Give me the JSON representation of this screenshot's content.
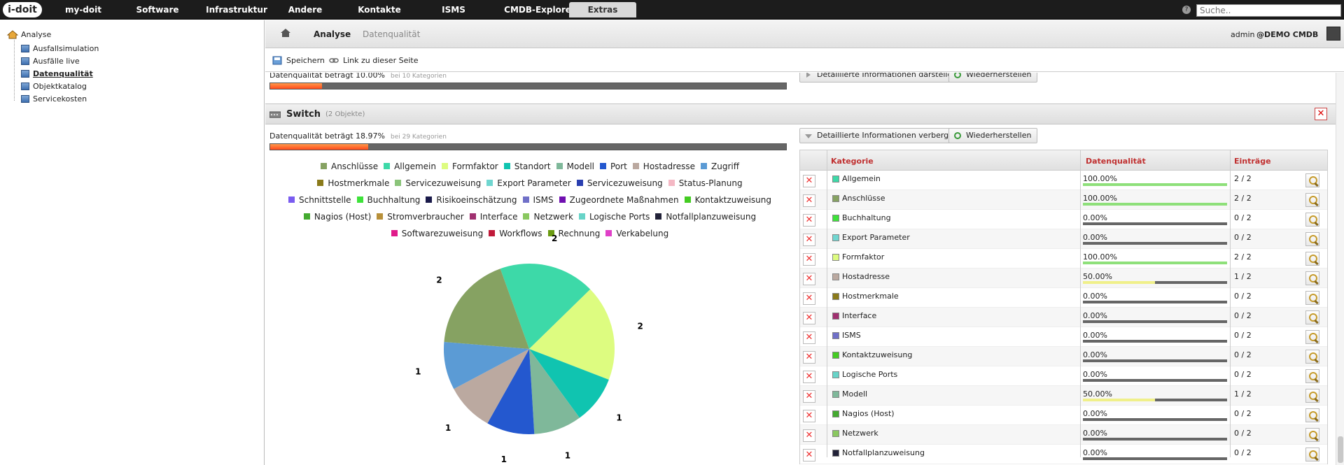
{
  "topnav": {
    "logo": "i-doit",
    "items": [
      "my-doit",
      "Software",
      "Infrastruktur",
      "Andere",
      "Kontakte",
      "ISMS",
      "CMDB-Explorer",
      "Extras"
    ],
    "active": "Extras",
    "search_placeholder": "Suche.."
  },
  "sidebar": {
    "root": "Analyse",
    "items": [
      "Ausfallsimulation",
      "Ausfälle live",
      "Datenqualität",
      "Objektkatalog",
      "Servicekosten"
    ],
    "current": "Datenqualität"
  },
  "breadcrumb": {
    "items": [
      "Analyse",
      "Datenqualität"
    ],
    "user": "admin",
    "tenant": "@DEMO CMDB"
  },
  "toolbar": {
    "save": "Speichern",
    "link": "Link zu dieser Seite"
  },
  "prev_section": {
    "quality_text": "Datenqualität beträgt 10.00%",
    "categories_text": "bei 10 Kategorien",
    "quality_percent": 10,
    "btn_details": "Detaillierte Informationen darstellen",
    "btn_restore": "Wiederherstellen"
  },
  "section": {
    "title": "Switch",
    "count": "(2 Objekte)",
    "quality_text": "Datenqualität beträgt 18.97%",
    "categories_text": "bei 29 Kategorien",
    "quality_percent": 18.97,
    "btn_details": "Detaillierte Informationen verbergen",
    "btn_restore": "Wiederherstellen"
  },
  "legend": [
    {
      "label": "Anschlüsse",
      "color": "#86a262"
    },
    {
      "label": "Allgemein",
      "color": "#3dd9a8"
    },
    {
      "label": "Formfaktor",
      "color": "#ddfc80"
    },
    {
      "label": "Standort",
      "color": "#10c4b0"
    },
    {
      "label": "Modell",
      "color": "#7fb89a"
    },
    {
      "label": "Port",
      "color": "#2458cf"
    },
    {
      "label": "Hostadresse",
      "color": "#bba9a0"
    },
    {
      "label": "Zugriff",
      "color": "#5b9bd5"
    },
    {
      "label": "Hostmerkmale",
      "color": "#8a7a1a"
    },
    {
      "label": "Servicezuweisung",
      "color": "#8bc47a"
    },
    {
      "label": "Export Parameter",
      "color": "#70d6d0"
    },
    {
      "label": "Servicezuweisung",
      "color": "#2a3fb0"
    },
    {
      "label": "Status-Planung",
      "color": "#f4b8c4"
    },
    {
      "label": "Schnittstelle",
      "color": "#7a5cf0"
    },
    {
      "label": "Buchhaltung",
      "color": "#3ee23a"
    },
    {
      "label": "Risikoeinschätzung",
      "color": "#1a1a4a"
    },
    {
      "label": "ISMS",
      "color": "#7070c8"
    },
    {
      "label": "Zugeordnete Maßnahmen",
      "color": "#7010b0"
    },
    {
      "label": "Kontaktzuweisung",
      "color": "#44cc22"
    },
    {
      "label": "Nagios (Host)",
      "color": "#44aa30"
    },
    {
      "label": "Stromverbraucher",
      "color": "#b8903a"
    },
    {
      "label": "Interface",
      "color": "#a03070"
    },
    {
      "label": "Netzwerk",
      "color": "#8ac860"
    },
    {
      "label": "Logische Ports",
      "color": "#68d4c8"
    },
    {
      "label": "Notfallplanzuweisung",
      "color": "#222238"
    },
    {
      "label": "Softwarezuweisung",
      "color": "#e01a8a"
    },
    {
      "label": "Workflows",
      "color": "#c01a3a"
    },
    {
      "label": "Rechnung",
      "color": "#6a9a10"
    },
    {
      "label": "Verkabelung",
      "color": "#e040c8"
    }
  ],
  "chart_data": {
    "type": "pie",
    "slices": [
      {
        "label": "Allgemein",
        "value": 2,
        "color": "#3dd9a8"
      },
      {
        "label": "Formfaktor",
        "value": 2,
        "color": "#ddfc80"
      },
      {
        "label": "Standort",
        "value": 1,
        "color": "#10c4b0"
      },
      {
        "label": "Modell",
        "value": 1,
        "color": "#7fb89a"
      },
      {
        "label": "Port",
        "value": 1,
        "color": "#2458cf"
      },
      {
        "label": "Hostadresse",
        "value": 1,
        "color": "#bba9a0"
      },
      {
        "label": "Zugriff",
        "value": 1,
        "color": "#5b9bd5"
      },
      {
        "label": "Anschlüsse",
        "value": 2,
        "color": "#86a262"
      }
    ]
  },
  "table": {
    "headers": [
      "Kategorie",
      "Datenqualität",
      "Einträge"
    ],
    "rows": [
      {
        "name": "Allgemein",
        "color": "#3dd9a8",
        "quality": "100.00%",
        "pct": 100,
        "entries": "2 / 2"
      },
      {
        "name": "Anschlüsse",
        "color": "#86a262",
        "quality": "100.00%",
        "pct": 100,
        "entries": "2 / 2"
      },
      {
        "name": "Buchhaltung",
        "color": "#3ee23a",
        "quality": "0.00%",
        "pct": 0,
        "entries": "0 / 2"
      },
      {
        "name": "Export Parameter",
        "color": "#70d6d0",
        "quality": "0.00%",
        "pct": 0,
        "entries": "0 / 2"
      },
      {
        "name": "Formfaktor",
        "color": "#ddfc80",
        "quality": "100.00%",
        "pct": 100,
        "entries": "2 / 2"
      },
      {
        "name": "Hostadresse",
        "color": "#bba9a0",
        "quality": "50.00%",
        "pct": 50,
        "entries": "1 / 2"
      },
      {
        "name": "Hostmerkmale",
        "color": "#8a7a1a",
        "quality": "0.00%",
        "pct": 0,
        "entries": "0 / 2"
      },
      {
        "name": "Interface",
        "color": "#a03070",
        "quality": "0.00%",
        "pct": 0,
        "entries": "0 / 2"
      },
      {
        "name": "ISMS",
        "color": "#7070c8",
        "quality": "0.00%",
        "pct": 0,
        "entries": "0 / 2"
      },
      {
        "name": "Kontaktzuweisung",
        "color": "#44cc22",
        "quality": "0.00%",
        "pct": 0,
        "entries": "0 / 2"
      },
      {
        "name": "Logische Ports",
        "color": "#68d4c8",
        "quality": "0.00%",
        "pct": 0,
        "entries": "0 / 2"
      },
      {
        "name": "Modell",
        "color": "#7fb89a",
        "quality": "50.00%",
        "pct": 50,
        "entries": "1 / 2"
      },
      {
        "name": "Nagios (Host)",
        "color": "#44aa30",
        "quality": "0.00%",
        "pct": 0,
        "entries": "0 / 2"
      },
      {
        "name": "Netzwerk",
        "color": "#8ac860",
        "quality": "0.00%",
        "pct": 0,
        "entries": "0 / 2"
      },
      {
        "name": "Notfallplanzuweisung",
        "color": "#222238",
        "quality": "0.00%",
        "pct": 0,
        "entries": "0 / 2"
      }
    ]
  }
}
